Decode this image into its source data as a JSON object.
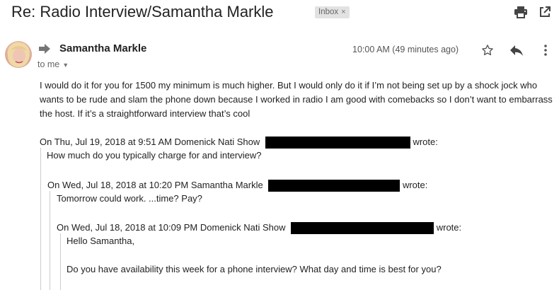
{
  "header": {
    "subject": "Re: Radio Interview/Samantha Markle",
    "label": "Inbox",
    "label_close": "×"
  },
  "icons": {
    "print": "print-icon",
    "open_new_window": "open-in-new-window-icon",
    "star": "star-icon",
    "reply": "reply-icon",
    "more": "more-vert-icon",
    "forward_arrow": "arrow-right-icon",
    "caret": "caret-down-icon"
  },
  "message": {
    "sender": "Samantha Markle",
    "recipient_label": "to me",
    "timestamp": "10:00 AM (49 minutes ago)",
    "body": "I would do it for you for 1500 my minimum is much higher. But I would only do it if I’m not being set up by a shock jock who wants to be rude and slam the phone down because I worked in radio I am good with comebacks so I don’t want to embarrass the host. If it’s a straightforward interview that’s cool"
  },
  "quotes": [
    {
      "attribution_prefix": "On Thu, Jul 19, 2018 at 9:51 AM Domenick Nati Show",
      "attribution_suffix": "wrote:",
      "lines": [
        "How much do you typically charge for and interview?"
      ]
    },
    {
      "attribution_prefix": "On Wed, Jul 18, 2018 at 10:20 PM Samantha Markle",
      "attribution_suffix": "wrote:",
      "lines": [
        "Tomorrow could work. ...time? Pay?"
      ]
    },
    {
      "attribution_prefix": "On Wed, Jul 18, 2018 at 10:09 PM Domenick Nati Show",
      "attribution_suffix": "wrote:",
      "lines": [
        "Hello Samantha,",
        "Do you have availability this week for a phone interview? What day and time is best for you?"
      ]
    }
  ],
  "colors": {
    "text": "#222222",
    "muted": "#666666",
    "icon": "#444444",
    "chip_bg": "#e2e2e2",
    "quote_bar": "#cccccc",
    "redaction": "#000000"
  }
}
